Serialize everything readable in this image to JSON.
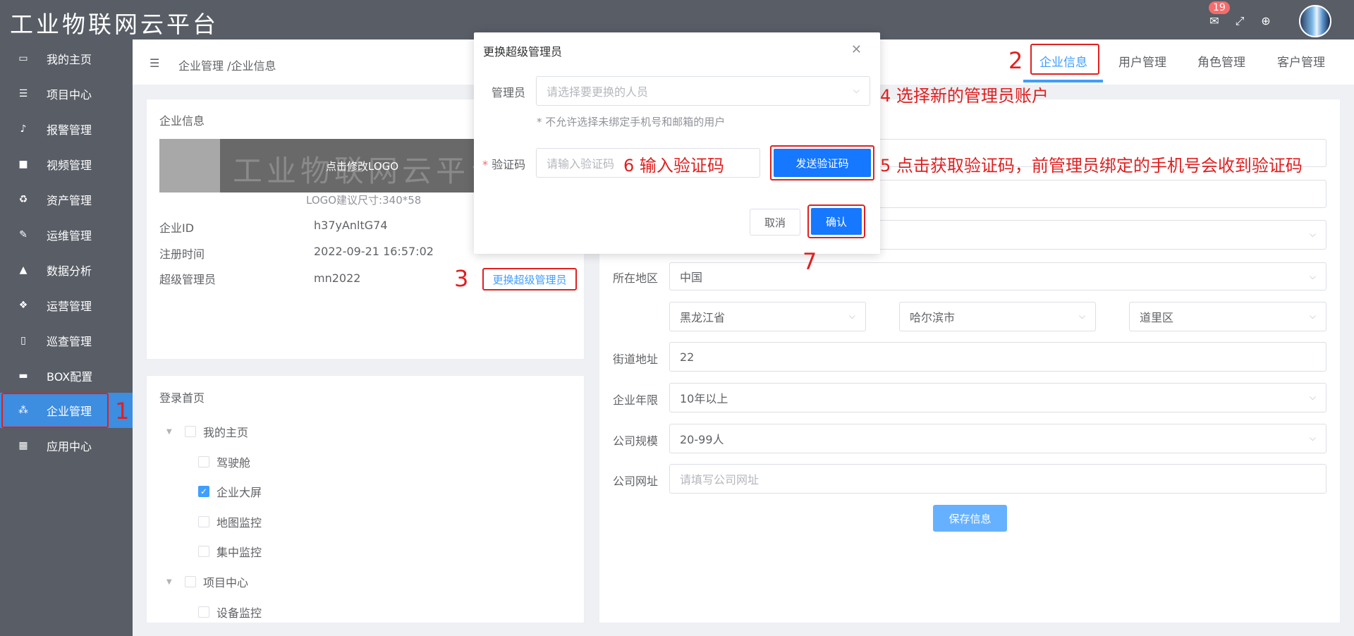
{
  "app": {
    "title": "工业物联网云平台",
    "notification_count": "19"
  },
  "top_icons": [
    "mail-icon",
    "fullscreen-icon",
    "globe-icon"
  ],
  "sidebar": {
    "items": [
      {
        "label": "我的主页",
        "icon": "laptop-icon"
      },
      {
        "label": "项目中心",
        "icon": "list-icon"
      },
      {
        "label": "报警管理",
        "icon": "bell-icon"
      },
      {
        "label": "视频管理",
        "icon": "video-icon"
      },
      {
        "label": "资产管理",
        "icon": "recycle-icon"
      },
      {
        "label": "运维管理",
        "icon": "wrench-icon"
      },
      {
        "label": "数据分析",
        "icon": "chart-icon"
      },
      {
        "label": "运营管理",
        "icon": "cubes-icon"
      },
      {
        "label": "巡查管理",
        "icon": "file-icon"
      },
      {
        "label": "BOX配置",
        "icon": "monitor-icon"
      },
      {
        "label": "企业管理",
        "icon": "org-icon",
        "active": true
      },
      {
        "label": "应用中心",
        "icon": "grid-icon"
      }
    ]
  },
  "header": {
    "breadcrumb": "企业管理 /企业信息",
    "tabs": [
      "企业信息",
      "用户管理",
      "角色管理",
      "客户管理"
    ],
    "active_tab": "企业信息"
  },
  "company_card": {
    "title": "企业信息",
    "logo_watermark": "工业物联网云平台",
    "logo_click_text": "点击修改LOGO",
    "logo_hint": "LOGO建议尺寸:340*58",
    "fields": [
      {
        "label": "企业ID",
        "value": "h37yAnltG74"
      },
      {
        "label": "注册时间",
        "value": "2022-09-21 16:57:02"
      },
      {
        "label": "超级管理员",
        "value": "mn2022"
      }
    ],
    "change_admin_link": "更换超级管理员"
  },
  "login_card": {
    "title": "登录首页",
    "tree": [
      {
        "label": "我的主页",
        "level": 0,
        "checked": false
      },
      {
        "label": "驾驶舱",
        "level": 1,
        "checked": false
      },
      {
        "label": "企业大屏",
        "level": 1,
        "checked": true
      },
      {
        "label": "地图监控",
        "level": 1,
        "checked": false
      },
      {
        "label": "集中监控",
        "level": 1,
        "checked": false
      },
      {
        "label": "项目中心",
        "level": 0,
        "checked": false
      },
      {
        "label": "设备监控",
        "level": 1,
        "checked": false
      }
    ]
  },
  "form": {
    "region_label": "所在地区",
    "country": "中国",
    "province": "黑龙江省",
    "city": "哈尔滨市",
    "district": "道里区",
    "street_label": "街道地址",
    "street": "22",
    "years_label": "企业年限",
    "years": "10年以上",
    "size_label": "公司规模",
    "size": "20-99人",
    "website_label": "公司网址",
    "website_placeholder": "请填写公司网址",
    "save_label": "保存信息"
  },
  "dialog": {
    "title": "更换超级管理员",
    "admin_label": "管理员",
    "admin_placeholder": "请选择要更换的人员",
    "tip": "* 不允许选择未绑定手机号和邮箱的用户",
    "code_label": "验证码",
    "code_placeholder": "请输入验证码",
    "send_label": "发送验证码",
    "cancel_label": "取消",
    "confirm_label": "确认"
  },
  "annotations": {
    "n1": "1",
    "n2": "2",
    "n3": "3",
    "a4": "4 选择新的管理员账户",
    "a5": "5 点击获取验证码，前管理员绑定的手机号会收到验证码",
    "a6": "6 输入验证码",
    "n7": "7"
  },
  "colors": {
    "sidebar_bg": "#585d66",
    "active_bg": "#3d8de0",
    "accent": "#409eff",
    "annotation": "#e02020"
  }
}
